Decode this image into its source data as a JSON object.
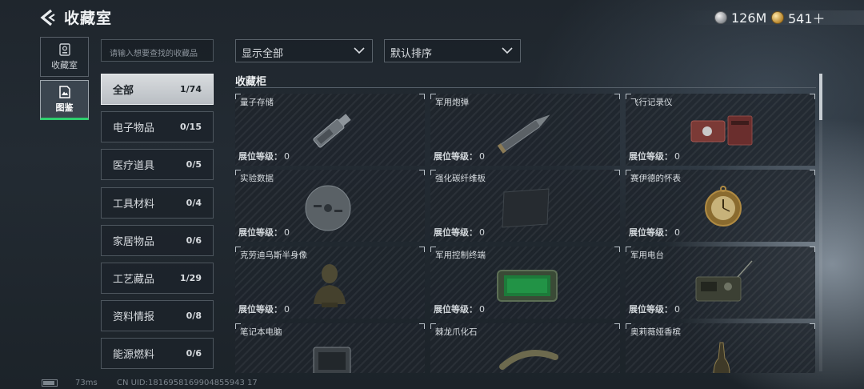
{
  "header": {
    "title": "收藏室",
    "currencies": [
      {
        "icon": "silver-coin-icon",
        "amount": "126M"
      },
      {
        "icon": "gold-coin-icon",
        "amount": "541＋"
      }
    ]
  },
  "mode_tabs": [
    {
      "label": "收藏室",
      "icon": "collection-box-icon",
      "active": false
    },
    {
      "label": "图鉴",
      "icon": "codex-image-icon",
      "active": true
    }
  ],
  "search": {
    "placeholder": "请输入想要查找的收藏品"
  },
  "categories": [
    {
      "name": "全部",
      "count": "1/74",
      "active": true
    },
    {
      "name": "电子物品",
      "count": "0/15",
      "active": false
    },
    {
      "name": "医疗道具",
      "count": "0/5",
      "active": false
    },
    {
      "name": "工具材料",
      "count": "0/4",
      "active": false
    },
    {
      "name": "家居物品",
      "count": "0/6",
      "active": false
    },
    {
      "name": "工艺藏品",
      "count": "1/29",
      "active": false
    },
    {
      "name": "资料情报",
      "count": "0/8",
      "active": false
    },
    {
      "name": "能源燃料",
      "count": "0/6",
      "active": false
    }
  ],
  "filters": {
    "display": "显示全部",
    "sort": "默认排序"
  },
  "section": {
    "title": "收藏柜"
  },
  "level_label": "展位等级：",
  "items": [
    {
      "name": "量子存储",
      "level": "0",
      "icon": "usb-drive-icon"
    },
    {
      "name": "军用炮弹",
      "level": "0",
      "icon": "artillery-shell-icon"
    },
    {
      "name": "飞行记录仪",
      "level": "0",
      "icon": "flight-recorder-icon"
    },
    {
      "name": "实验数据",
      "level": "0",
      "icon": "data-disc-icon"
    },
    {
      "name": "强化碳纤维板",
      "level": "0",
      "icon": "carbon-fiber-plate-icon"
    },
    {
      "name": "赛伊德的怀表",
      "level": "0",
      "icon": "pocket-watch-icon"
    },
    {
      "name": "克劳迪乌斯半身像",
      "level": "0",
      "icon": "bust-statue-icon"
    },
    {
      "name": "军用控制终端",
      "level": "0",
      "icon": "control-terminal-icon"
    },
    {
      "name": "军用电台",
      "level": "0",
      "icon": "military-radio-icon"
    },
    {
      "name": "笔记本电脑",
      "level": "",
      "icon": "laptop-icon"
    },
    {
      "name": "棘龙爪化石",
      "level": "",
      "icon": "claw-fossil-icon"
    },
    {
      "name": "奥莉薇娅香槟",
      "level": "",
      "icon": "champagne-bottle-icon"
    }
  ],
  "footer": {
    "ping": "73ms",
    "uid": "CN UID:1816958169904855943 17"
  }
}
